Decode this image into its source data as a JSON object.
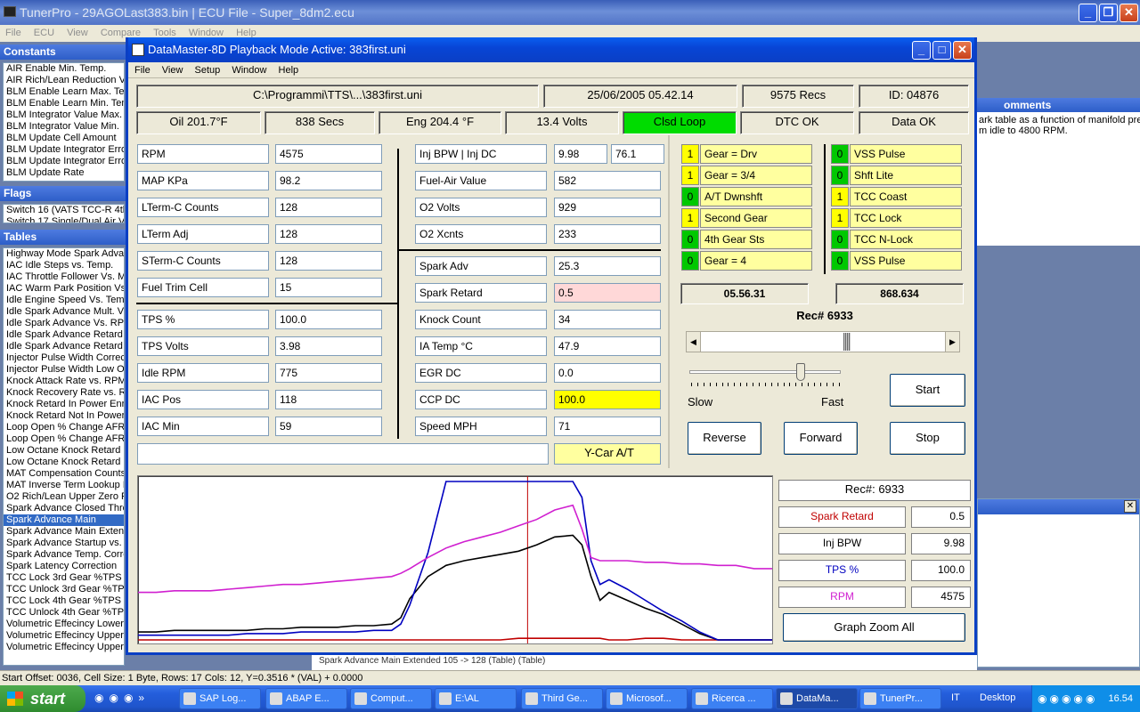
{
  "main_window": {
    "title": "TunerPro - 29AGOLast383.bin | ECU File - Super_8dm2.ecu",
    "menu": [
      "File",
      "ECU",
      "View",
      "Compare",
      "Tools",
      "Window",
      "Help"
    ]
  },
  "constants_panel": {
    "title": "Constants",
    "items": [
      "AIR Enable Min. Temp.",
      "AIR Rich/Lean Reduction Vo",
      "BLM Enable Learn Max. Tem",
      "BLM Enable Learn Min. Temp",
      "BLM Integrator Value Max.",
      "BLM Integrator Value Min.",
      "BLM Update Cell Amount",
      "BLM Update Integrator Erro",
      "BLM Update Integrator Erro",
      "BLM Update Rate"
    ]
  },
  "flags_panel": {
    "title": "Flags",
    "items": [
      "Switch 16 (VATS TCC-R 4th",
      "Switch 17 Single/Dual Air Vo"
    ]
  },
  "tables_panel": {
    "title": "Tables",
    "items": [
      "Highway Mode Spark Advan",
      "IAC Idle Steps vs. Temp.",
      "IAC Throttle Follower Vs. MF",
      "IAC Warm Park Position Vs.",
      "Idle Engine Speed Vs. Temp",
      "Idle Spark Advance Mult. Vs",
      "Idle Spark Advance Vs. RPM",
      "Idle Spark Advance Retard V",
      "Idle Spark Advance Retard V",
      "Injector Pulse Width Correct",
      "Injector Pulse Width Low Of",
      "Knock Attack Rate vs. RPM",
      "Knock Recovery Rate vs. R",
      "Knock Retard In Power Enric",
      "Knock Retard Not In Power",
      "Loop Open % Change AFR V",
      "Loop Open % Change AFR V",
      "Low Octane Knock Retard M",
      "Low Octane Knock Retard M",
      "MAT Compensation Counts",
      "MAT Inverse Term Lookup D",
      "O2 Rich/Lean Upper Zero Re",
      "Spark Advance Closed Thro",
      "Spark Advance Main",
      "Spark Advance Main Extend",
      "Spark Advance Startup vs. T",
      "Spark Advance Temp. Corre",
      "Spark Latency Correction",
      "TCC Lock 3rd Gear %TPS Vs",
      "TCC Unlock 3rd Gear %TPS",
      "TCC Lock 4th Gear %TPS Vs",
      "TCC Unlock 4th Gear %TPS",
      "Volumetric Effecincy Lower T",
      "Volumetric Effecincy Upper T",
      "Volumetric Effecincy Upper T"
    ],
    "selected_index": 23
  },
  "comments_panel": {
    "title": "omments",
    "lines": [
      "ark table as a function of manifold pres",
      "m idle to 4800 RPM."
    ]
  },
  "bottom_table_row": {
    "text": "Spark Advance Main Extended        105 -> 128        (Table)        (Table)"
  },
  "status_bar": "Start Offset: 0036,  Cell Size: 1 Byte,  Rows: 17 Cols: 12,   Y=0.3516 * (VAL) + 0.0000",
  "datamaster": {
    "title": "DataMaster-8D  Playback Mode Active: 383first.uni",
    "menu": [
      "File",
      "View",
      "Setup",
      "Window",
      "Help"
    ],
    "header": {
      "path": "C:\\Programmi\\TTS\\...\\383first.uni",
      "datetime": "25/06/2005  05.42.14",
      "recs": "9575 Recs",
      "id": "ID:  04876"
    },
    "status_row": {
      "oil": "Oil  201.7°F",
      "secs": "838 Secs",
      "eng": "Eng  204.4 °F",
      "volts": "13.4 Volts",
      "loop": "Clsd Loop",
      "dtc": "DTC OK",
      "data": "Data OK"
    },
    "params_left": [
      {
        "label": "RPM",
        "value": "4575"
      },
      {
        "label": "MAP KPa",
        "value": "98.2"
      },
      {
        "label": "LTerm-C Counts",
        "value": "128"
      },
      {
        "label": "LTerm Adj",
        "value": "128"
      },
      {
        "label": "STerm-C Counts",
        "value": "128"
      },
      {
        "label": "Fuel Trim Cell",
        "value": "15"
      },
      {
        "label": "TPS %",
        "value": "100.0"
      },
      {
        "label": "TPS Volts",
        "value": "3.98"
      },
      {
        "label": "Idle RPM",
        "value": "775"
      },
      {
        "label": "IAC Pos",
        "value": "118"
      },
      {
        "label": "IAC Min",
        "value": "59"
      }
    ],
    "params_mid": [
      {
        "label": "Inj BPW  |  Inj DC",
        "value": "9.98",
        "value2": "76.1"
      },
      {
        "label": "Fuel-Air Value",
        "value": "582"
      },
      {
        "label": "O2 Volts",
        "value": "929"
      },
      {
        "label": "O2 Xcnts",
        "value": "233"
      },
      {
        "label": "Spark Adv",
        "value": "25.3"
      },
      {
        "label": "Spark Retard",
        "value": "0.5"
      },
      {
        "label": "Knock Count",
        "value": "34"
      },
      {
        "label": "IA Temp °C",
        "value": "47.9"
      },
      {
        "label": "EGR DC",
        "value": "0.0"
      },
      {
        "label": "CCP DC",
        "value": "100.0"
      },
      {
        "label": "Speed MPH",
        "value": "71"
      }
    ],
    "car_type": "Y-Car A/T",
    "flags_left": [
      {
        "state": "1",
        "label": "Gear = Drv"
      },
      {
        "state": "1",
        "label": "Gear = 3/4"
      },
      {
        "state": "0",
        "label": "A/T Dwnshft"
      },
      {
        "state": "1",
        "label": "Second Gear"
      },
      {
        "state": "0",
        "label": "4th Gear Sts"
      },
      {
        "state": "0",
        "label": "Gear = 4"
      }
    ],
    "flags_right": [
      {
        "state": "0",
        "label": "VSS Pulse"
      },
      {
        "state": "0",
        "label": "Shft Lite"
      },
      {
        "state": "1",
        "label": "TCC Coast"
      },
      {
        "state": "1",
        "label": "TCC Lock"
      },
      {
        "state": "0",
        "label": "TCC N-Lock"
      },
      {
        "state": "0",
        "label": "VSS Pulse"
      }
    ],
    "time_display": "05.56.31",
    "counter_display": "868.634",
    "rec_label": "Rec# 6933",
    "playback_position": 0.6,
    "speed_position": 0.75,
    "speed_slow": "Slow",
    "speed_fast": "Fast",
    "buttons": {
      "start": "Start",
      "reverse": "Reverse",
      "forward": "Forward",
      "stop": "Stop",
      "zoom": "Graph Zoom All"
    },
    "legend": {
      "rec": "Rec#:  6933",
      "items": [
        {
          "label": "Spark Retard",
          "value": "0.5",
          "color": "#c00000"
        },
        {
          "label": "Inj BPW",
          "value": "9.98",
          "color": "#000000"
        },
        {
          "label": "TPS %",
          "value": "100.0",
          "color": "#0000c0"
        },
        {
          "label": "RPM",
          "value": "4575",
          "color": "#d020d0"
        }
      ]
    }
  },
  "chart_data": {
    "type": "line",
    "x": [
      0,
      20,
      40,
      60,
      80,
      100,
      120,
      140,
      160,
      180,
      200,
      220,
      240,
      260,
      280,
      290,
      300,
      320,
      340,
      360,
      380,
      400,
      420,
      440,
      460,
      480,
      490,
      500,
      510,
      520,
      540,
      560,
      580,
      600,
      620,
      640,
      660,
      680,
      700
    ],
    "cursor_x": 430,
    "series": [
      {
        "name": "Spark Retard",
        "color": "#c00000",
        "values": [
          0,
          0,
          0,
          0,
          0,
          0,
          0,
          0,
          0,
          0,
          0,
          0,
          0,
          0,
          0,
          0,
          0,
          0,
          0,
          0,
          0,
          0,
          1,
          1,
          1,
          1,
          1,
          1,
          1,
          0,
          0,
          1,
          1,
          0,
          0,
          0,
          0,
          0,
          0
        ]
      },
      {
        "name": "Inj BPW",
        "color": "#000000",
        "values": [
          5,
          5,
          6,
          6,
          6,
          6,
          6,
          7,
          7,
          8,
          8,
          8,
          9,
          9,
          10,
          14,
          26,
          40,
          47,
          50,
          52,
          54,
          56,
          60,
          65,
          66,
          60,
          40,
          25,
          30,
          25,
          20,
          16,
          10,
          4,
          0,
          0,
          0,
          0
        ]
      },
      {
        "name": "TPS %",
        "color": "#0000c0",
        "values": [
          3,
          3,
          3,
          3,
          3,
          3,
          4,
          4,
          4,
          5,
          5,
          5,
          5,
          6,
          6,
          10,
          22,
          55,
          100,
          100,
          100,
          100,
          100,
          100,
          100,
          100,
          90,
          50,
          35,
          38,
          32,
          25,
          18,
          12,
          5,
          0,
          0,
          0,
          0
        ]
      },
      {
        "name": "RPM",
        "color": "#d020d0",
        "values": [
          30,
          30,
          31,
          31,
          31,
          32,
          33,
          34,
          35,
          35,
          36,
          37,
          38,
          39,
          40,
          42,
          45,
          52,
          58,
          62,
          65,
          68,
          72,
          76,
          82,
          85,
          70,
          52,
          50,
          50,
          50,
          49,
          49,
          48,
          48,
          47,
          47,
          45,
          45
        ]
      }
    ],
    "ylim": [
      0,
      100
    ],
    "xlabel": "",
    "ylabel": ""
  },
  "taskbar": {
    "start": "start",
    "items": [
      "SAP Log...",
      "ABAP E...",
      "Comput...",
      "E:\\AL",
      "Third Ge...",
      "Microsof...",
      "Ricerca ...",
      "DataMa...",
      "TunerPr..."
    ],
    "active_index": 7,
    "lang": "IT",
    "desktop": "Desktop",
    "clock": "16.54"
  }
}
